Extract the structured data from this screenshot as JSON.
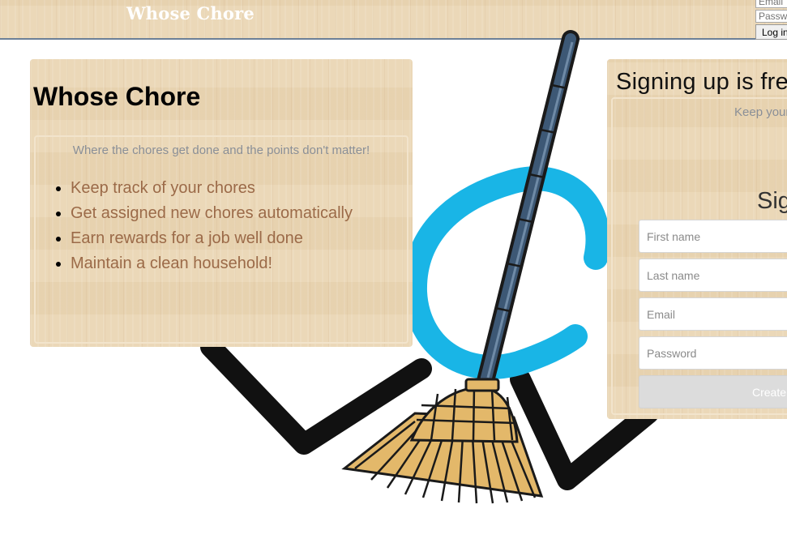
{
  "header": {
    "brand": "Whose Chore",
    "login": {
      "email_placeholder": "Email",
      "password_placeholder": "Password",
      "button_label": "Log in"
    }
  },
  "intro": {
    "title": "Whose Chore",
    "tagline": "Where the chores get done and the points don't matter!",
    "features": [
      "Keep track of your chores",
      "Get assigned new chores automatically",
      "Earn rewards for a job well done",
      "Maintain a clean household!"
    ]
  },
  "signup": {
    "title": "Signing up is free",
    "tagline": "Keep your",
    "heading": "Sign",
    "first_name_placeholder": "First name",
    "last_name_placeholder": "Last name",
    "email_placeholder": "Email",
    "password_placeholder": "Password",
    "button_label": "Create"
  },
  "colors": {
    "wood": "#ead6b4",
    "brand_text": "#ffffff",
    "feature_text": "#9b6a48",
    "tagline_text": "#8a8f97",
    "logo_cyan": "#19b5e6",
    "broom_handle": "#3d5875",
    "broom_straw": "#e3b86a"
  }
}
